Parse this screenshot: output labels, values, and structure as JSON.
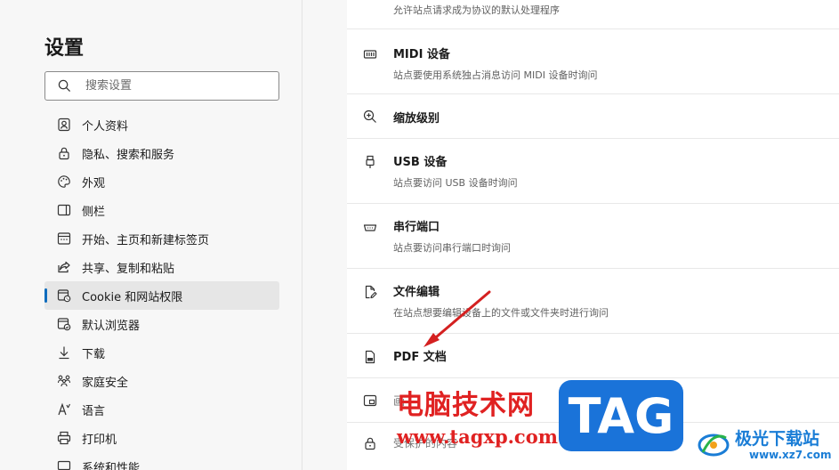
{
  "sidebar": {
    "title": "设置",
    "search_placeholder": "搜索设置",
    "items": [
      {
        "label": "个人资料",
        "icon": "profile-icon"
      },
      {
        "label": "隐私、搜索和服务",
        "icon": "lock-icon"
      },
      {
        "label": "外观",
        "icon": "palette-icon"
      },
      {
        "label": "侧栏",
        "icon": "sidebar-icon"
      },
      {
        "label": "开始、主页和新建标签页",
        "icon": "home-grid-icon"
      },
      {
        "label": "共享、复制和粘贴",
        "icon": "share-icon"
      },
      {
        "label": "Cookie 和网站权限",
        "icon": "cookie-icon",
        "active": true
      },
      {
        "label": "默认浏览器",
        "icon": "browser-icon"
      },
      {
        "label": "下载",
        "icon": "download-icon"
      },
      {
        "label": "家庭安全",
        "icon": "family-icon"
      },
      {
        "label": "语言",
        "icon": "language-icon"
      },
      {
        "label": "打印机",
        "icon": "printer-icon"
      },
      {
        "label": "系统和性能",
        "icon": "system-icon"
      }
    ]
  },
  "main": {
    "partial_top_desc": "允许站点请求成为协议的默认处理程序",
    "rows": [
      {
        "title": "MIDI 设备",
        "desc": "站点要使用系统独占消息访问 MIDI 设备时询问",
        "icon": "midi-icon"
      },
      {
        "title": "缩放级别",
        "desc": "",
        "icon": "zoom-icon"
      },
      {
        "title": "USB 设备",
        "desc": "站点要访问 USB 设备时询问",
        "icon": "usb-icon"
      },
      {
        "title": "串行端口",
        "desc": "站点要访问串行端口时询问",
        "icon": "serial-port-icon"
      },
      {
        "title": "文件编辑",
        "desc": "在站点想要编辑设备上的文件或文件夹时进行询问",
        "icon": "file-edit-icon"
      },
      {
        "title": "PDF 文档",
        "desc": "",
        "icon": "pdf-icon"
      },
      {
        "title": "画",
        "desc": "",
        "icon": "picture-icon"
      },
      {
        "title": "受保护的内容",
        "desc": "",
        "icon": "protected-content-icon"
      }
    ]
  },
  "watermark": {
    "text": "电脑技术网",
    "url": "www.tagxp.com",
    "badge": "TAG",
    "brand_name": "极光下载站",
    "brand_site": "www.xz7.com"
  },
  "colors": {
    "accent": "#0f6cbd",
    "watermark_red": "#e02222",
    "badge_blue": "#1a73d9",
    "brand_blue": "#1a7dd6"
  }
}
